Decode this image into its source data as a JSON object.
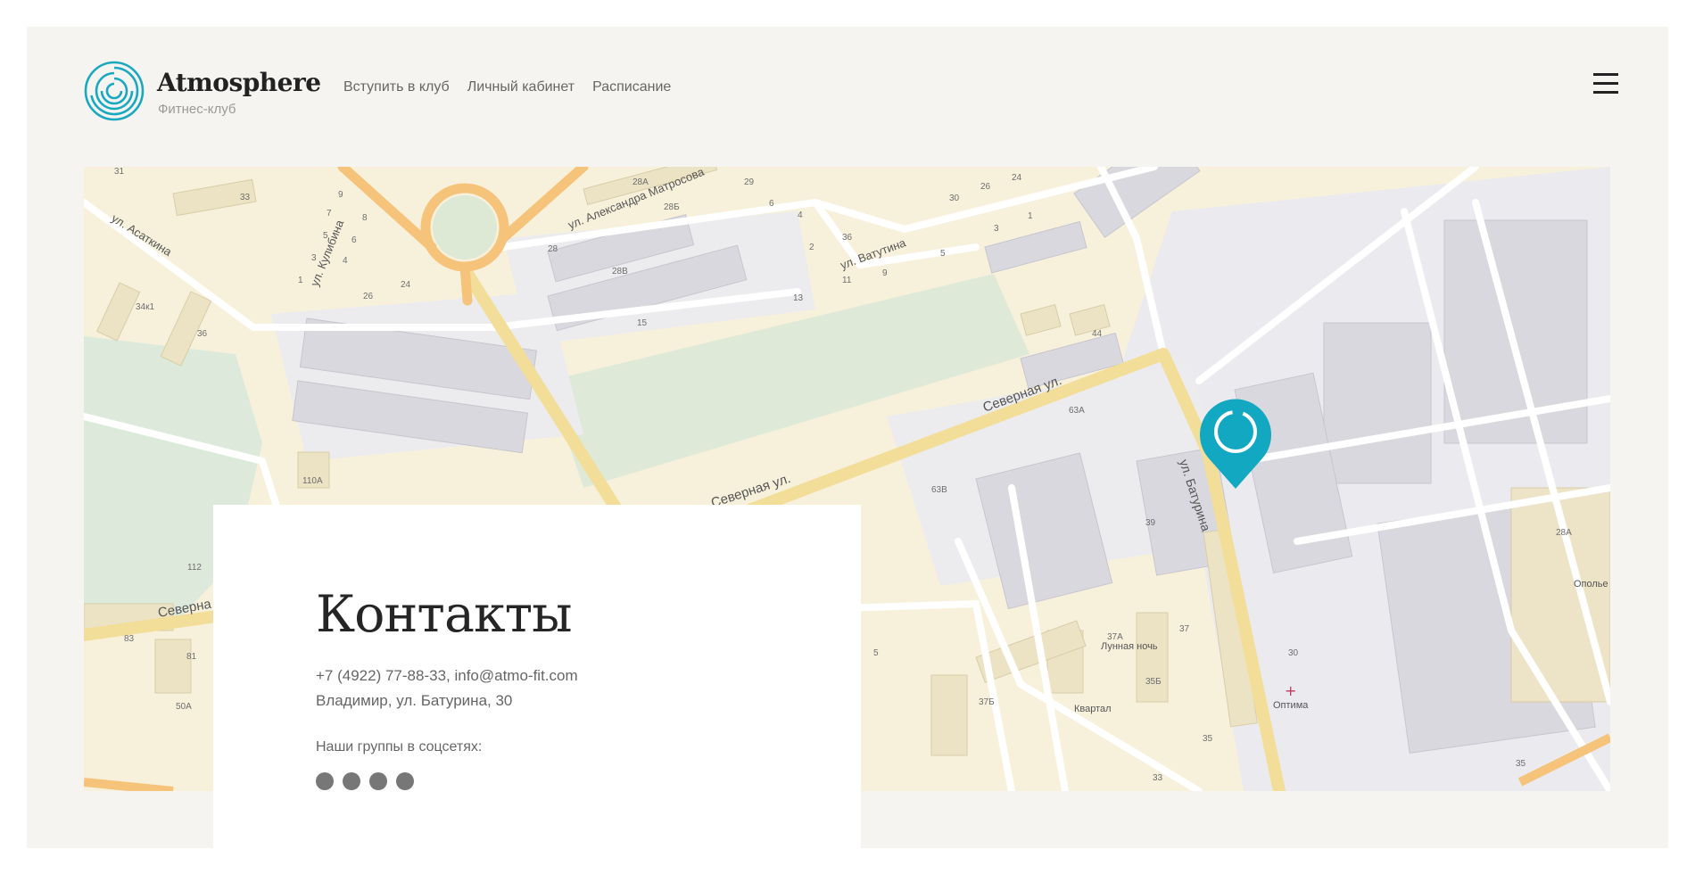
{
  "header": {
    "brand": "Atmosphere",
    "tagline": "Фитнес-клуб",
    "nav": [
      "Вступить в клуб",
      "Личный кабинет",
      "Расписание"
    ],
    "menu_icon": "hamburger-icon"
  },
  "contacts": {
    "title": "Контакты",
    "phone_email": "+7 (4922) 77-88-33, info@atmo-fit.com",
    "address": "Владимир, ул. Батурина, 30",
    "social_label": "Наши группы в соцсетях:",
    "social_icons": [
      "social-icon-1",
      "social-icon-2",
      "social-icon-3",
      "social-icon-4"
    ]
  },
  "map": {
    "marker_icon": "club-location-pin-icon",
    "accent_color": "#12a8c2",
    "streets": [
      "ул. Асаткина",
      "ул. Кулибина",
      "ул. Александра Матросова",
      "ул. Ватутина",
      "Северная ул.",
      "Северная ул.",
      "ул. Батурина",
      "Северна"
    ],
    "house_numbers": [
      "31",
      "33",
      "9",
      "7",
      "8",
      "5",
      "6",
      "3",
      "4",
      "1",
      "26",
      "24",
      "36",
      "34к1",
      "28А",
      "28Б",
      "28",
      "28В",
      "15",
      "13",
      "11",
      "9",
      "5",
      "3",
      "1",
      "30",
      "26",
      "24",
      "36",
      "2",
      "4",
      "6",
      "29",
      "44",
      "63А",
      "63В",
      "39",
      "37",
      "37А",
      "35Б",
      "37Б",
      "35",
      "33",
      "30",
      "28А",
      "35",
      "112",
      "110А",
      "83",
      "81",
      "50А",
      "5"
    ],
    "poi": [
      "Лунная ночь",
      "Квартал",
      "Оптима",
      "Ополье"
    ]
  }
}
